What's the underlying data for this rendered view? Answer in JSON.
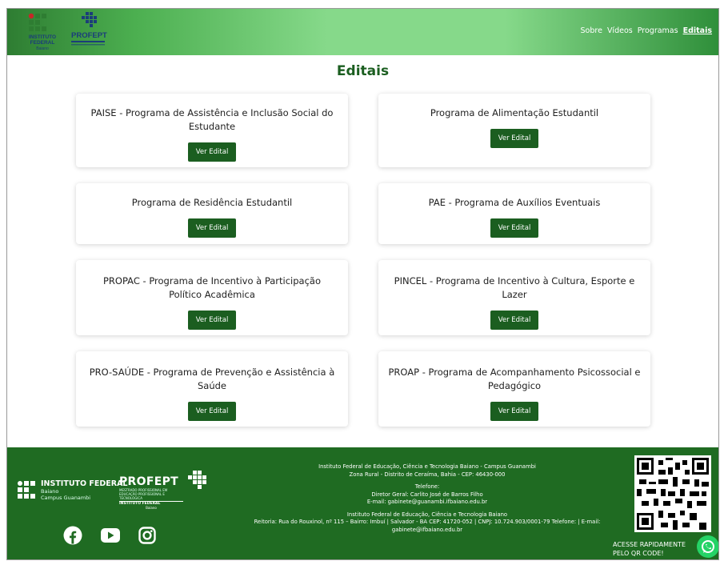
{
  "header": {
    "logo_if_lines": [
      "INSTITUTO",
      "FEDERAL",
      "Baiano"
    ],
    "logo_profept": "PROFEPT",
    "nav": [
      "Sobre",
      "Vídeos",
      "Programas",
      "Editais"
    ],
    "active_nav": "Editais"
  },
  "page_title": "Editais",
  "button_label": "Ver Edital",
  "cards": [
    "PAISE - Programa de Assistência e Inclusão Social do Estudante",
    "Programa de Alimentação Estudantil",
    "Programa de Residência Estudantil",
    "PAE - Programa de Auxílios Eventuais",
    "PROPAC - Programa de Incentivo à Participação Político Acadêmica",
    "PINCEL - Programa de Incentivo à Cultura, Esporte e Lazer",
    "PRO-SAÚDE - Programa de Prevenção e Assistência à Saúde",
    "PROAP - Programa de Acompanhamento Psicossocial e Pedagógico"
  ],
  "footer": {
    "if_name": "INSTITUTO FEDERAL",
    "if_sub1": "Baiano",
    "if_sub2": "Campus Guanambi",
    "profept": "PROFEPT",
    "profept_sub": "MESTRADO PROFISSIONAL EM EDUCAÇÃO PROFISSIONAL E TECNOLÓGICA",
    "profept_inst": "INSTITUTO FEDERAL",
    "profept_inst_sub": "Baiano",
    "lines": [
      "Instituto Federal de Educação, Ciência e Tecnologia Baiano - Campus Guanambi",
      "Zona Rural - Distrito de Ceraíma, Bahia - CEP: 46430-000",
      "Telefone:",
      "Diretor Geral: Carlito José de Barros Filho",
      "E-mail: gabinete@guanambi.ifbaiano.edu.br",
      "Instituto Federal de Educação, Ciência e Tecnologia Baiano",
      "Reitoria: Rua do Rouxinol, nº 115 – Bairro: Imbuí | Salvador - BA CEP: 41720-052 | CNPJ: 10.724.903/0001-79 Telefone: | E-mail:",
      "gabinete@ifbaiano.edu.br"
    ],
    "qr_text": "ACESSE RAPIDAMENTE PELO QR CODE!"
  },
  "colors": {
    "brand_green": "#1b5e20",
    "footer_green": "#1f6b22",
    "whatsapp": "#25d366"
  }
}
